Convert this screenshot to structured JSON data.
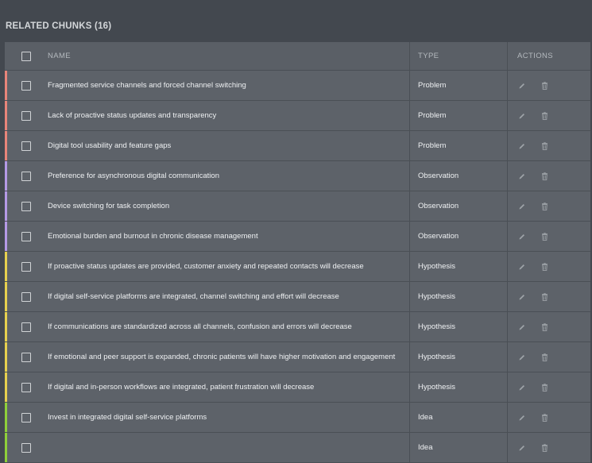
{
  "section_title": "RELATED CHUNKS (16)",
  "columns": {
    "name": "NAME",
    "type": "TYPE",
    "actions": "ACTIONS"
  },
  "type_colors": {
    "Problem": "#e8857a",
    "Observation": "#b59ae6",
    "Hypothesis": "#e6d04f",
    "Idea": "#8fcf3a"
  },
  "rows": [
    {
      "name": "Fragmented service channels and forced channel switching",
      "type": "Problem"
    },
    {
      "name": "Lack of proactive status updates and transparency",
      "type": "Problem"
    },
    {
      "name": "Digital tool usability and feature gaps",
      "type": "Problem"
    },
    {
      "name": "Preference for asynchronous digital communication",
      "type": "Observation"
    },
    {
      "name": "Device switching for task completion",
      "type": "Observation"
    },
    {
      "name": "Emotional burden and burnout in chronic disease management",
      "type": "Observation"
    },
    {
      "name": "If proactive status updates are provided, customer anxiety and repeated contacts will decrease",
      "type": "Hypothesis"
    },
    {
      "name": "If digital self-service platforms are integrated, channel switching and effort will decrease",
      "type": "Hypothesis"
    },
    {
      "name": "If communications are standardized across all channels, confusion and errors will decrease",
      "type": "Hypothesis"
    },
    {
      "name": "If emotional and peer support is expanded, chronic patients will have higher motivation and engagement",
      "type": "Hypothesis"
    },
    {
      "name": "If digital and in-person workflows are integrated, patient frustration will decrease",
      "type": "Hypothesis"
    },
    {
      "name": "Invest in integrated digital self-service platforms",
      "type": "Idea"
    },
    {
      "name": "",
      "type": "Idea"
    }
  ],
  "icons": {
    "edit": "pencil-icon",
    "delete": "trash-icon"
  }
}
